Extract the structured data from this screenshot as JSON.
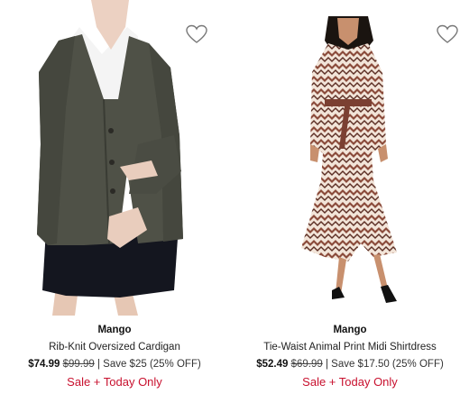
{
  "products": [
    {
      "brand": "Mango",
      "title": "Rib-Knit Oversized Cardigan",
      "sale_price": "$74.99",
      "original_price": "$99.99",
      "savings": "| Save $25 (25% OFF)",
      "promo": "Sale + Today Only",
      "image_desc_icon": "cardigan-product-image",
      "favorite_icon": "heart-outline-icon"
    },
    {
      "brand": "Mango",
      "title": "Tie-Waist Animal Print Midi Shirtdress",
      "sale_price": "$52.49",
      "original_price": "$69.99",
      "savings": "| Save $17.50 (25% OFF)",
      "promo": "Sale + Today Only",
      "image_desc_icon": "shirtdress-product-image",
      "favorite_icon": "heart-outline-icon"
    }
  ],
  "colors": {
    "promo": "#c8102e",
    "text": "#222222",
    "background": "#ffffff"
  }
}
